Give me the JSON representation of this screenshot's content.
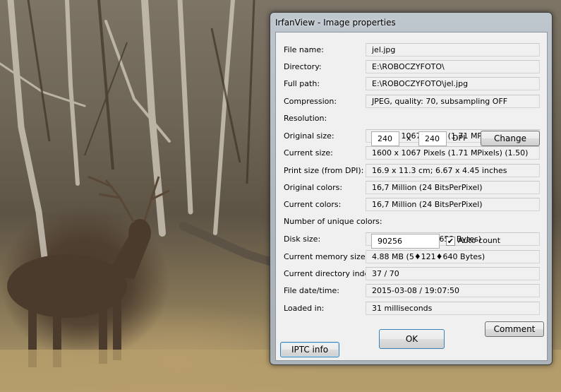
{
  "window": {
    "title": "IrfanView - Image properties"
  },
  "fields": [
    {
      "label": "File name:",
      "value": "jel.jpg"
    },
    {
      "label": "Directory:",
      "value": "E:\\ROBOCZYFOTO\\"
    },
    {
      "label": "Full path:",
      "value": "E:\\ROBOCZYFOTO\\jel.jpg"
    },
    {
      "label": "Compression:",
      "value": "JPEG, quality: 70, subsampling OFF"
    },
    {
      "label": "Resolution:",
      "value": ""
    },
    {
      "label": "Original size:",
      "value": "1600 x 1067  Pixels (1.71 MPixels) (1.50)"
    },
    {
      "label": "Current size:",
      "value": "1600 x 1067  Pixels (1.71 MPixels) (1.50)"
    },
    {
      "label": "Print size (from DPI):",
      "value": "16.9 x 11.3 cm; 6.67 x 4.45 inches"
    },
    {
      "label": "Original colors:",
      "value": "16,7 Million   (24 BitsPerPixel)"
    },
    {
      "label": "Current colors:",
      "value": "16,7 Million   (24 BitsPerPixel)"
    },
    {
      "label": "Number of unique colors:",
      "value": ""
    },
    {
      "label": "Disk size:",
      "value": "341.46 KB (349♦653 Bytes)"
    },
    {
      "label": "Current memory size:",
      "value": "4.88  MB (5♦121♦640 Bytes)"
    },
    {
      "label": "Current directory index:",
      "value": "37  /  70"
    },
    {
      "label": "File date/time:",
      "value": "2015-03-08 / 19:07:50"
    },
    {
      "label": "Loaded in:",
      "value": "31 milliseconds"
    }
  ],
  "resolution": {
    "x": "240",
    "separator": "x",
    "y": "240",
    "unit": "DPI",
    "change_label": "Change"
  },
  "unique_colors": {
    "value": "90256",
    "auto_count_label": "Auto count",
    "auto_count_checked": true,
    "check_mark": "✔"
  },
  "buttons": {
    "comment": "Comment",
    "ok": "OK",
    "iptc": "IPTC info"
  }
}
